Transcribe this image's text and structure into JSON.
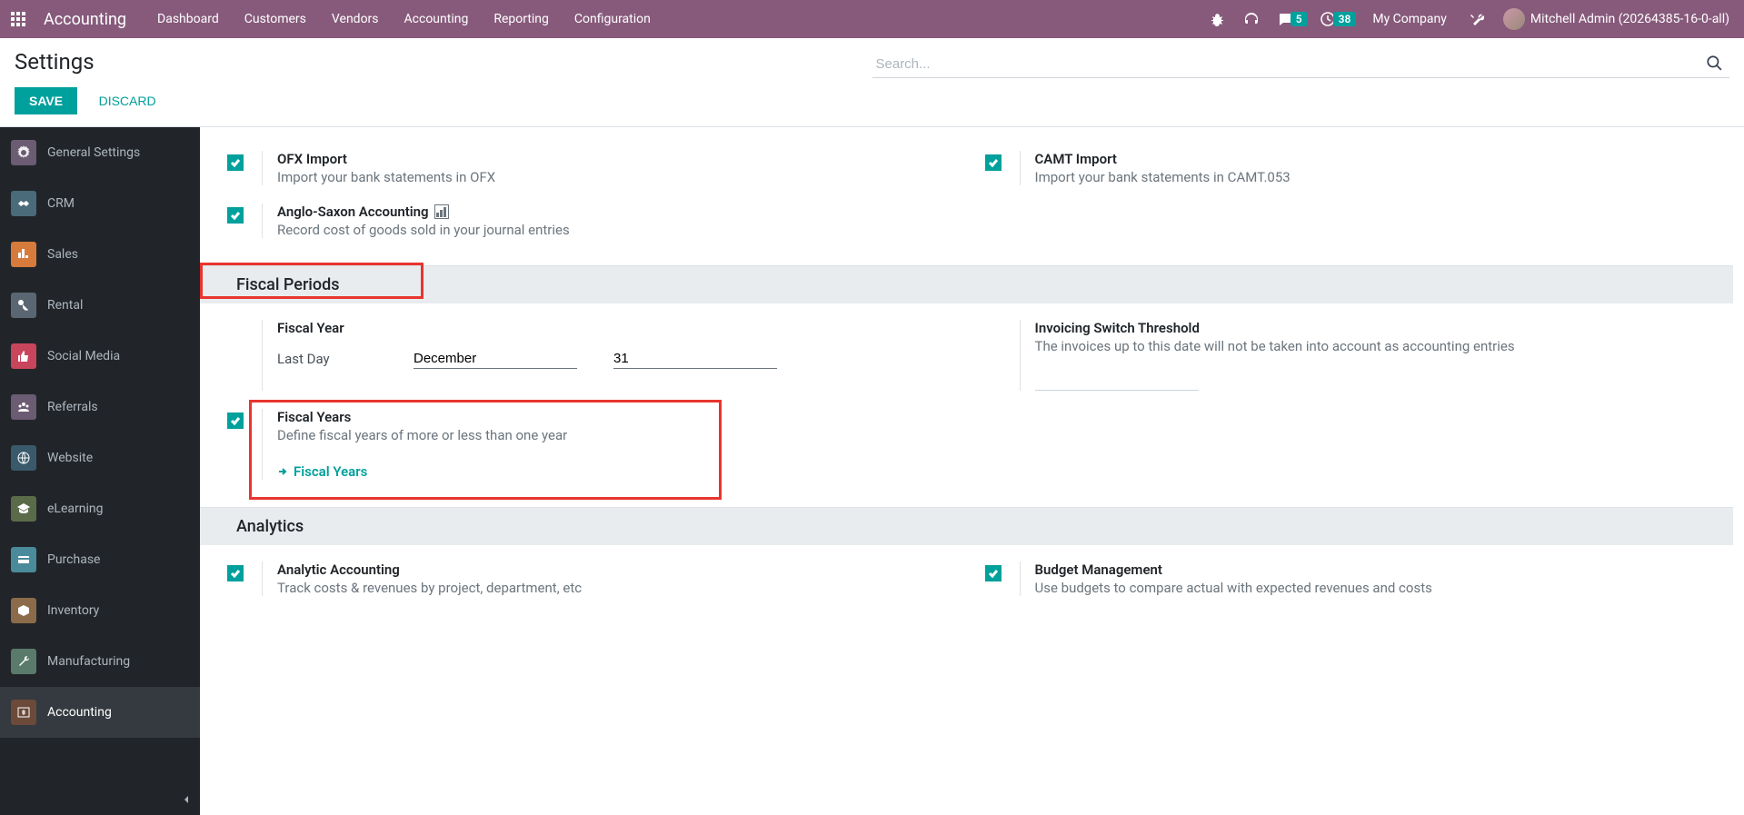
{
  "navbar": {
    "app_name": "Accounting",
    "menu": [
      "Dashboard",
      "Customers",
      "Vendors",
      "Accounting",
      "Reporting",
      "Configuration"
    ],
    "chat_badge": "5",
    "clock_badge": "38",
    "company": "My Company",
    "user": "Mitchell Admin (20264385-16-0-all)"
  },
  "control": {
    "title": "Settings",
    "save": "SAVE",
    "discard": "DISCARD",
    "search_placeholder": "Search..."
  },
  "sidebar": {
    "items": [
      {
        "label": "General Settings",
        "color": "#6b5b73"
      },
      {
        "label": "CRM",
        "color": "#4a6b7a"
      },
      {
        "label": "Sales",
        "color": "#d67b3c"
      },
      {
        "label": "Rental",
        "color": "#5a6773"
      },
      {
        "label": "Social Media",
        "color": "#c9455b"
      },
      {
        "label": "Referrals",
        "color": "#6b5b73"
      },
      {
        "label": "Website",
        "color": "#3a5a6b"
      },
      {
        "label": "eLearning",
        "color": "#5a6b4a"
      },
      {
        "label": "Purchase",
        "color": "#4a8b9b"
      },
      {
        "label": "Inventory",
        "color": "#8b6b4a"
      },
      {
        "label": "Manufacturing",
        "color": "#5a7a6b"
      },
      {
        "label": "Accounting",
        "color": "#6b4a3a"
      }
    ]
  },
  "settings": {
    "ofx": {
      "title": "OFX Import",
      "desc": "Import your bank statements in OFX"
    },
    "camt": {
      "title": "CAMT Import",
      "desc": "Import your bank statements in CAMT.053"
    },
    "anglo": {
      "title": "Anglo-Saxon Accounting",
      "desc": "Record cost of goods sold in your journal entries"
    },
    "fiscal_section": "Fiscal Periods",
    "fiscal_year": {
      "title": "Fiscal Year",
      "last_day_label": "Last Day",
      "month": "December",
      "day": "31"
    },
    "invoicing": {
      "title": "Invoicing Switch Threshold",
      "desc": "The invoices up to this date will not be taken into account as accounting entries"
    },
    "fiscal_years": {
      "title": "Fiscal Years",
      "desc": "Define fiscal years of more or less than one year",
      "link": "Fiscal Years"
    },
    "analytics_section": "Analytics",
    "analytic": {
      "title": "Analytic Accounting",
      "desc": "Track costs & revenues by project, department, etc"
    },
    "budget": {
      "title": "Budget Management",
      "desc": "Use budgets to compare actual with expected revenues and costs"
    }
  }
}
